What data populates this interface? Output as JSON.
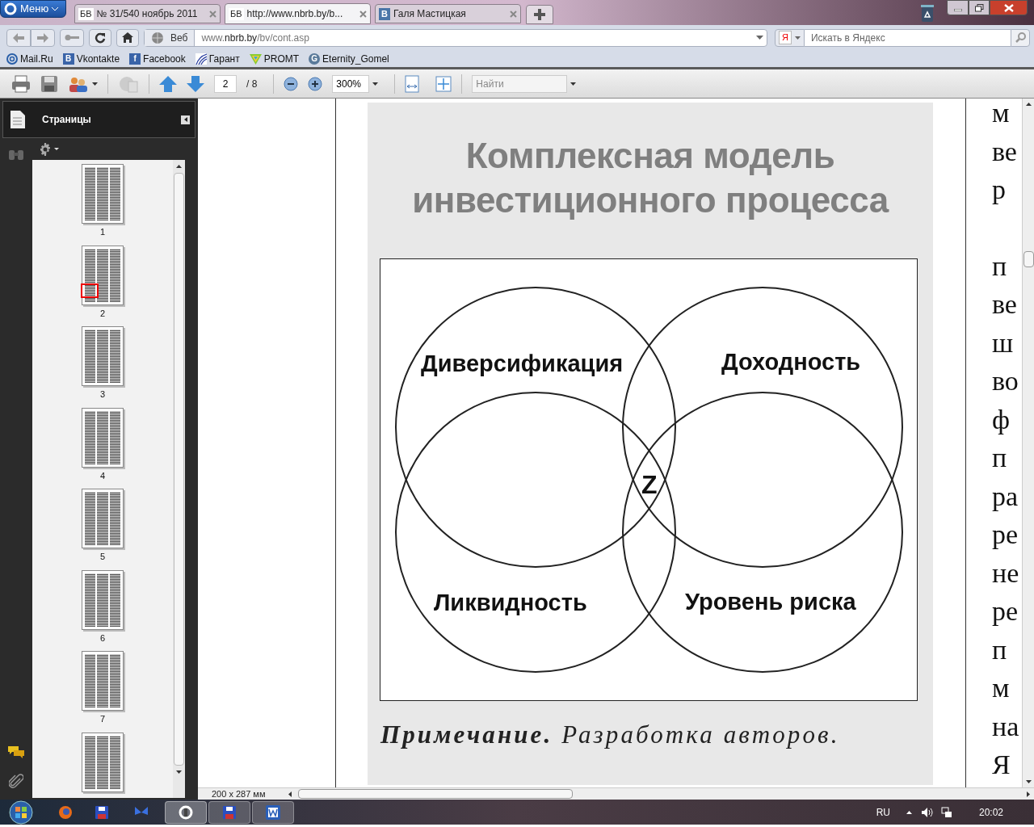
{
  "browser": {
    "menu_button": "Меню",
    "tabs": [
      {
        "icon_text": "БВ",
        "title": "№ 31/540 ноябрь 2011",
        "selected": false
      },
      {
        "icon_text": "БВ",
        "title": "http://www.nbrb.by/b...",
        "selected": true
      },
      {
        "icon_text": "В",
        "title": "Галя Мастицкая",
        "selected": false
      }
    ],
    "address_mode": "Веб",
    "url": [
      {
        "text": "www.",
        "emphasis": false
      },
      {
        "text": "nbrb.by",
        "emphasis": true
      },
      {
        "text": "/bv/cont.asp",
        "emphasis": false
      }
    ],
    "search_engine_icon": "Я",
    "search_placeholder": "Искать в Яндекс",
    "bookmarks": [
      {
        "kind": "mail",
        "label": "Mail.Ru"
      },
      {
        "kind": "letter",
        "icon_text": "В",
        "label": "Vkontakte"
      },
      {
        "kind": "letter",
        "icon_text": "f",
        "label": "Facebook"
      },
      {
        "kind": "garant",
        "label": "Гарант"
      },
      {
        "kind": "promt",
        "label": "PROMT"
      },
      {
        "kind": "round",
        "icon_text": "G",
        "label": "Eternity_Gomel"
      }
    ]
  },
  "reader": {
    "toolbar": {
      "page": "2",
      "page_total": "/ 8",
      "zoom": "300%",
      "find_placeholder": "Найти"
    },
    "sidebar": {
      "title": "Страницы",
      "thumbnails": [
        {
          "label": "1",
          "selected": false
        },
        {
          "label": "2",
          "selected": true
        },
        {
          "label": "3",
          "selected": false
        },
        {
          "label": "4",
          "selected": false
        },
        {
          "label": "5",
          "selected": false
        },
        {
          "label": "6",
          "selected": false
        },
        {
          "label": "7",
          "selected": false
        },
        {
          "selected": false
        }
      ]
    },
    "figure": {
      "title_lines": [
        "Комплексная модель",
        "инвестиционного процесса"
      ],
      "venn_labels": [
        "Диверсификация",
        "Доходность",
        "Ликвидность",
        "Уровень риска"
      ],
      "center_label": "Z",
      "note": "**Примечание.** Разработка авторов."
    },
    "column_paragraphs": [
      [
        "м",
        "ве",
        "р"
      ],
      [
        "п",
        "ве",
        "ш",
        "во",
        "ф",
        "п",
        "ра",
        "ре",
        "не",
        "ре",
        "п",
        "м",
        "на",
        "Я"
      ]
    ],
    "page_size": "200 x 287 мм"
  },
  "taskbar": {
    "language": "RU",
    "time": "20:02"
  }
}
